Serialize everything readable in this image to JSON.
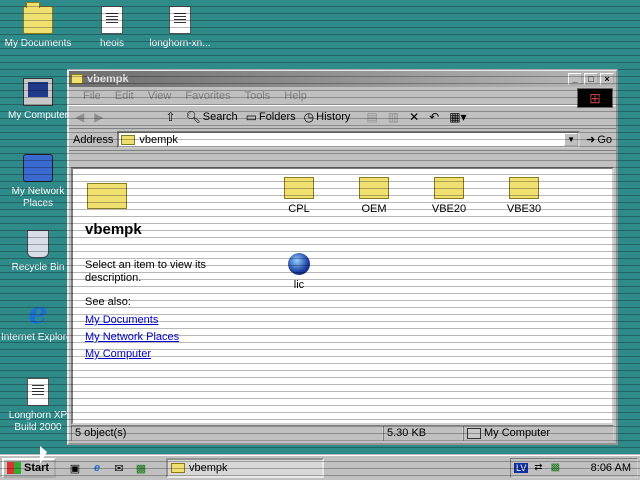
{
  "desktop": {
    "icons": [
      {
        "label": "My Documents",
        "icon": "folder-icon"
      },
      {
        "label": "heois",
        "icon": "document-icon"
      },
      {
        "label": "longhorn-xn...",
        "icon": "document-icon"
      },
      {
        "label": "My Computer",
        "icon": "computer-icon"
      },
      {
        "label": "My Network Places",
        "icon": "network-icon"
      },
      {
        "label": "Recycle Bin",
        "icon": "recycle-bin-icon"
      },
      {
        "label": "Internet Explorer",
        "icon": "ie-icon"
      },
      {
        "label": "Longhorn XP Build 2000",
        "icon": "document-icon"
      }
    ]
  },
  "window": {
    "title": "vbempk",
    "menu": [
      "File",
      "Edit",
      "View",
      "Favorites",
      "Tools",
      "Help"
    ],
    "toolbar": {
      "search": "Search",
      "folders": "Folders",
      "history": "History"
    },
    "address": {
      "label": "Address",
      "value": "vbempk",
      "go": "Go"
    },
    "webview": {
      "title": "vbempk",
      "description": "Select an item to view its description.",
      "see_also": "See also:",
      "links": [
        "My Documents",
        "My Network Places",
        "My Computer"
      ]
    },
    "items": [
      {
        "label": "CPL",
        "icon": "folder-icon"
      },
      {
        "label": "OEM",
        "icon": "folder-icon"
      },
      {
        "label": "VBE20",
        "icon": "folder-icon"
      },
      {
        "label": "VBE30",
        "icon": "folder-icon"
      },
      {
        "label": "lic",
        "icon": "globe-icon"
      }
    ],
    "status": {
      "objects": "5 object(s)",
      "size": "5.30 KB",
      "zone": "My Computer"
    }
  },
  "taskbar": {
    "start": "Start",
    "task": "vbempk",
    "tray_lang": "LV",
    "clock": "8:06 AM"
  }
}
